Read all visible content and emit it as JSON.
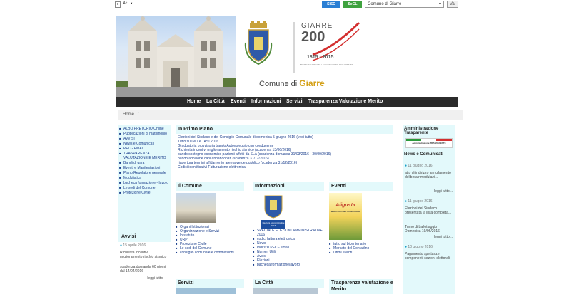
{
  "topbar": {
    "btn_c": "c",
    "btn_aa": "A⁺",
    "btn_contrast": "◐",
    "logo1": "SISC",
    "logo2": "SeGL",
    "select_value": "Comune di Giarre",
    "go_label": "Vai"
  },
  "header": {
    "brand_name": "GIARRE",
    "brand_year": "200",
    "brand_years": "1815 - 2015",
    "brand_sub": "BICENTENARIO DELLA FONDAZIONE DEL COMUNE",
    "comune_prefix": "Comune di ",
    "comune_name": "Giarre"
  },
  "nav": {
    "items": [
      "Home",
      "La Città",
      "Eventi",
      "Informazioni",
      "Servizi",
      "Trasparenza Valutazione Merito"
    ]
  },
  "breadcrumb": {
    "home": "Home",
    "sep": "/"
  },
  "left_menu": {
    "items": [
      "ALBO PRETORIO Online",
      "Pubblicazioni di matrimonio",
      "AVVISI",
      "News e Comunicati",
      "PEC - EMAIL",
      "TRASPARENZA VALUTAZIONE E MERITO",
      "Bandi di gara",
      "Eventi e Manifestazioni",
      "Piano Regolatore generale",
      "Modulistica",
      "bacheca formazione - lavoro",
      "Le sedi del Comune",
      "Protezione Civile"
    ]
  },
  "avvisi": {
    "title": "Avvisi",
    "date": "15 aprile 2016",
    "text": "Richiesta incentivi miglioramento rischio sismico",
    "deadline": "scadenza domanda 60 giorni dal 14/04/2016",
    "more": "leggi tutto"
  },
  "primo_piano": {
    "title": "In Primo Piano",
    "lines": [
      "Elezioni del Sindaco e del Consiglio  Comunale di domenica 5 giugno 2016  (vedi tutto)",
      "Tutto su IMU e TASI 2016",
      "Graduatoria provvisoria bando Autonoleggio con conducente",
      "Richiesta incentivi miglioramento rischio sismico (scadenza 13/06/2016)",
      "bando sostegno economico pazienti affetti da SLA (scadenza domanda 31/03/2016 - 30/09/2016)",
      "bando adozione cani abbandonati (scadenza 31/12/2016)",
      "riapertura termini affidamento aree a verde pubblico (scadenza 31/12/2016)",
      "Codici identificativi Fatturazione elettronica"
    ]
  },
  "il_comune": {
    "title": "Il Comune",
    "items": [
      "Organi Istituzionali",
      "Organizzazione e Servizi",
      "lo statuto",
      "URP",
      "Protezione Civile",
      "Le sedi del Comune",
      "consiglio comunale e commissioni"
    ]
  },
  "informazioni": {
    "title": "Informazioni",
    "badge": "Elezioni Amministrative 2016",
    "items": [
      "SPECIALE ELEZIONI AMMINISTRATIVE 2016",
      "codici fattura elettronica",
      "News",
      "Indirizzi PEC - email",
      "Numeri Utili",
      "Avvisi",
      "Elezioni",
      "bacheca formazione/lavoro"
    ]
  },
  "eventi": {
    "title": "Eventi",
    "poster_title": "Aligusta",
    "poster_sub": "MERCATO DEL CONTADINO",
    "items": [
      "tutto sul bicentenario",
      "Mercato del Contadino",
      "ultimi eventi"
    ]
  },
  "bottom_sections": {
    "servizi": "Servizi",
    "la_citta": "La Città",
    "trasparenza": "Trasparenza valutazione e Merito"
  },
  "right_col": {
    "amm_title": "Amministrazione Trasparente",
    "amm_banner": "Amministrazione TRASPARENTE",
    "news_title": "News e Comunicati",
    "news": [
      {
        "date": "11 giugno 2016",
        "text": "atto di indirizzo annullamento delibera rimodulazi...",
        "more": "leggi tutto..."
      },
      {
        "date": "11 giugno 2016",
        "text": "Elezioni del Sindaco presentata la lista completa...",
        "more": ""
      },
      {
        "date": "",
        "text": "Turno di ballottaggio Domenica 19/06/2016",
        "more": "leggi tutto..."
      },
      {
        "date": "10 giugno 2016",
        "text": "Pagamento spettanze componenti sezioni elettorali",
        "more": ""
      }
    ]
  }
}
